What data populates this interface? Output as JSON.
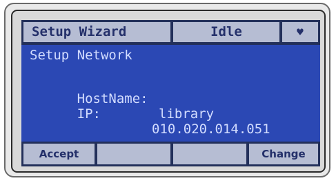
{
  "header": {
    "title": "Setup Wizard",
    "status": "Idle",
    "heart_symbol": "♥",
    "heart_icon": "heart-icon"
  },
  "screen": {
    "title": "Setup Network",
    "hostname_label": "HostName:",
    "hostname_value": "library",
    "ip_label": "IP:",
    "ip_value": "010.020.014.051"
  },
  "softkeys": {
    "key1": "Accept",
    "key2": "",
    "key3": "",
    "key4": "Change"
  },
  "colors": {
    "screen_blue": "#2b48b4",
    "frame_navy": "#23305a",
    "key_gray": "#b6bdd3",
    "text_light": "#d2dcff"
  }
}
